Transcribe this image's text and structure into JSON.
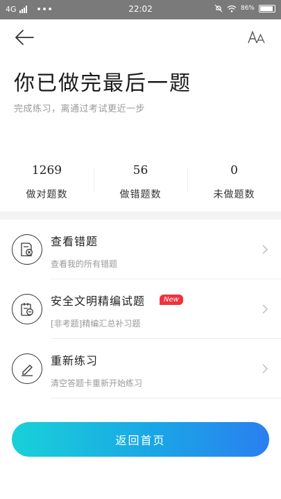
{
  "status_bar": {
    "network": "4G",
    "dots": "•••",
    "time": "22:02",
    "battery": "86%"
  },
  "header": {
    "title": "你已做完最后一题",
    "subtitle": "完成练习，离通过考试更近一步"
  },
  "stats": [
    {
      "value": "1269",
      "label": "做对题数"
    },
    {
      "value": "56",
      "label": "做错题数"
    },
    {
      "value": "0",
      "label": "未做题数"
    }
  ],
  "menu": [
    {
      "title": "查看错题",
      "description": "查看我的所有错题",
      "icon": "wrong-question-icon"
    },
    {
      "title": "安全文明精编试题",
      "description": "[非考题]精编汇总补习题",
      "icon": "compiled-questions-icon",
      "badge": "New"
    },
    {
      "title": "重新练习",
      "description": "清空答题卡重新开始练习",
      "icon": "pencil-icon"
    }
  ],
  "bottom_button": {
    "label": "返回首页"
  },
  "colors": {
    "accent_start": "#19d1d8",
    "accent_end": "#2a7fef",
    "badge": "#f0323c"
  }
}
